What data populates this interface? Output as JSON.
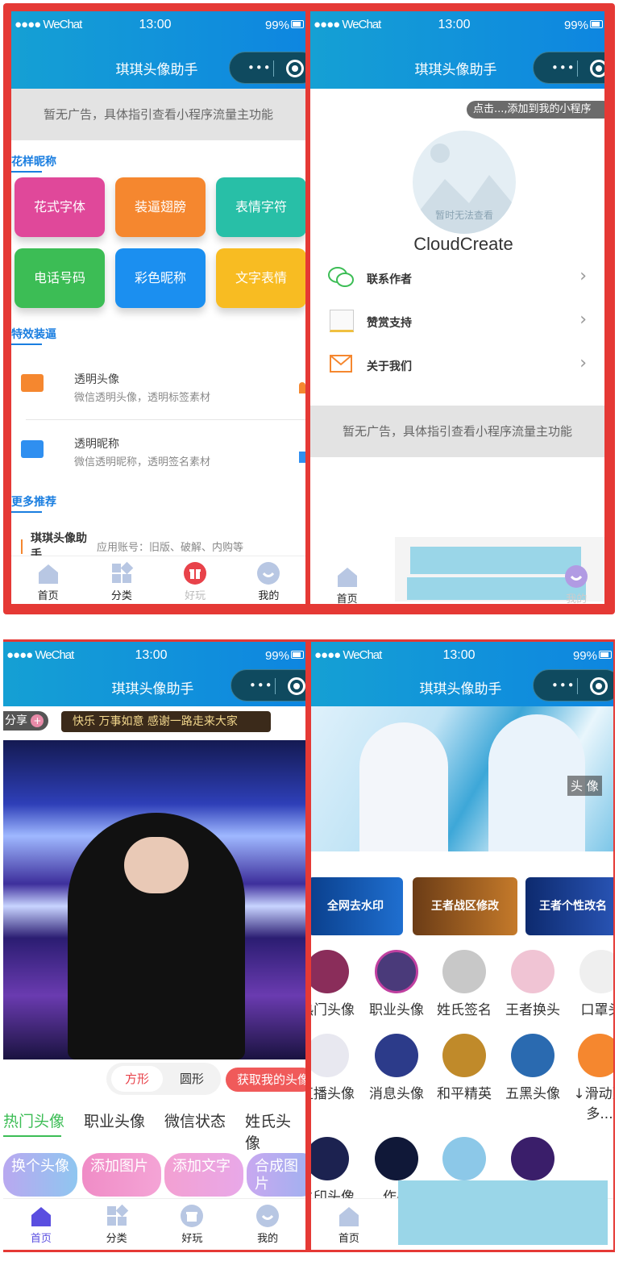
{
  "frame_color": "#e53935",
  "status": {
    "carrier": "●●●● WeChat",
    "time": "13:00",
    "battery": "99%"
  },
  "app_title": "琪琪头像助手",
  "capsule": {
    "more": "•••"
  },
  "tabbar": {
    "home": "首页",
    "category": "分类",
    "fun": "好玩",
    "mine": "我的"
  },
  "panel1": {
    "ad": "暂无广告，具体指引查看小程序流量主功能",
    "section_fancy": "花样昵称",
    "buttons": [
      {
        "label": "花式字体",
        "color": "#e0489a"
      },
      {
        "label": "装逼翅膀",
        "color": "#f5872f"
      },
      {
        "label": "表情字符",
        "color": "#28bfa7"
      },
      {
        "label": "电话号码",
        "color": "#3cbd55"
      },
      {
        "label": "彩色昵称",
        "color": "#1b8ff0"
      },
      {
        "label": "文字表情",
        "color": "#f8bc22"
      }
    ],
    "section_effects": "特效装逼",
    "effects": [
      {
        "title": "透明头像",
        "desc": "微信透明头像，透明标签素材"
      },
      {
        "title": "透明昵称",
        "desc": "微信透明昵称，透明签名素材"
      }
    ],
    "section_more": "更多推荐",
    "recommend": {
      "name": "琪琪头像助手",
      "desc": "应用账号：旧版、破解、内购等"
    }
  },
  "panel2": {
    "tip": "点击...,添加到我的小程序",
    "avatar_note": "暂时无法查看",
    "username": "CloudCreate",
    "menu": [
      {
        "label": "联系作者"
      },
      {
        "label": "赞赏支持"
      },
      {
        "label": "关于我们"
      }
    ],
    "ad": "暂无广告，具体指引查看小程序流量主功能"
  },
  "panel3": {
    "share": "分享",
    "marquee": "快乐 万事如意 感谢一路走来大家",
    "shape_square": "方形",
    "shape_round": "圆形",
    "get_avatar": "获取我的头像",
    "tabs": [
      "热门头像",
      "职业头像",
      "微信状态",
      "姓氏头像"
    ],
    "actions": [
      "换个头像",
      "添加图片",
      "添加文字",
      "合成图片"
    ]
  },
  "panel4": {
    "hero_tag": "头 像",
    "banners": [
      "全网去水印",
      "王者战区修改",
      "王者个性改名"
    ],
    "cats_row1": [
      "热门头像",
      "职业头像",
      "姓氏签名",
      "王者换头",
      "口罩头"
    ],
    "cats_row2": [
      "直播头像",
      "消息头像",
      "和平精英",
      "五黑头像",
      "↓滑动更多..."
    ],
    "cats_row3": [
      "水印头像",
      "作品"
    ]
  }
}
